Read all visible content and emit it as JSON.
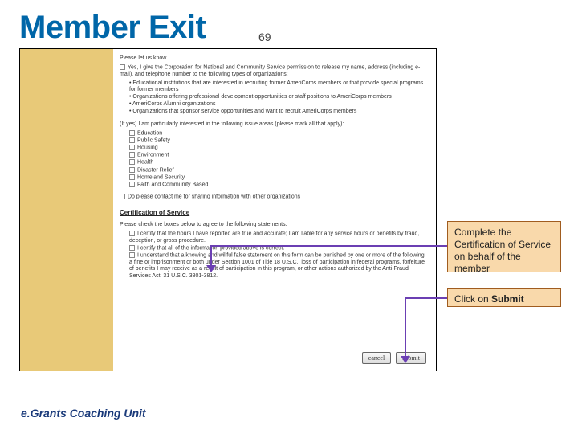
{
  "title": "Member Exit",
  "slide_number": "69",
  "footer": "e.Grants Coaching Unit",
  "form": {
    "intro": "Please let us know",
    "consent": "Yes, I give the Corporation for National and Community Service permission to release my name, address (including e-mail), and telephone number to the following types of organizations:",
    "orgs": [
      "Educational institutions that are interested in recruiting former AmeriCorps members or that provide special programs for former members",
      "Organizations offering professional development opportunities or staff positions to AmeriCorps members",
      "AmeriCorps Alumni organizations",
      "Organizations that sponsor service opportunities and want to recruit AmeriCorps members"
    ],
    "interest_intro": "(If yes) I am particularly interested in the following issue areas (please mark all that apply):",
    "interests": [
      "Education",
      "Public Safety",
      "Housing",
      "Environment",
      "Health",
      "Disaster Relief",
      "Homeland Security",
      "Faith and Community Based"
    ],
    "share_note": "Do please contact me for sharing information with other organizations",
    "cert_heading": "Certification of Service",
    "cert_intro": "Please check the boxes below to agree to the following statements:",
    "cert_items": [
      "I certify that the hours I have reported are true and accurate; I am liable for any service hours or benefits by fraud, deception, or gross procedure.",
      "I certify that all of the information provided above is correct.",
      "I understand that a knowing and willful false statement on this form can be punished by one or more of the following: a fine or imprisonment or both under Section 1001 of Title 18 U.S.C., loss of participation in federal programs, forfeiture of benefits I may receive as a result of participation in this program, or other actions authorized by the Anti-Fraud Services Act, 31 U.S.C. 3801-3812."
    ],
    "btn_cancel": "cancel",
    "btn_submit": "submit"
  },
  "callout1": "Complete the Certification of Service on behalf of the member",
  "callout2_pre": "Click on ",
  "callout2_bold": "Submit"
}
